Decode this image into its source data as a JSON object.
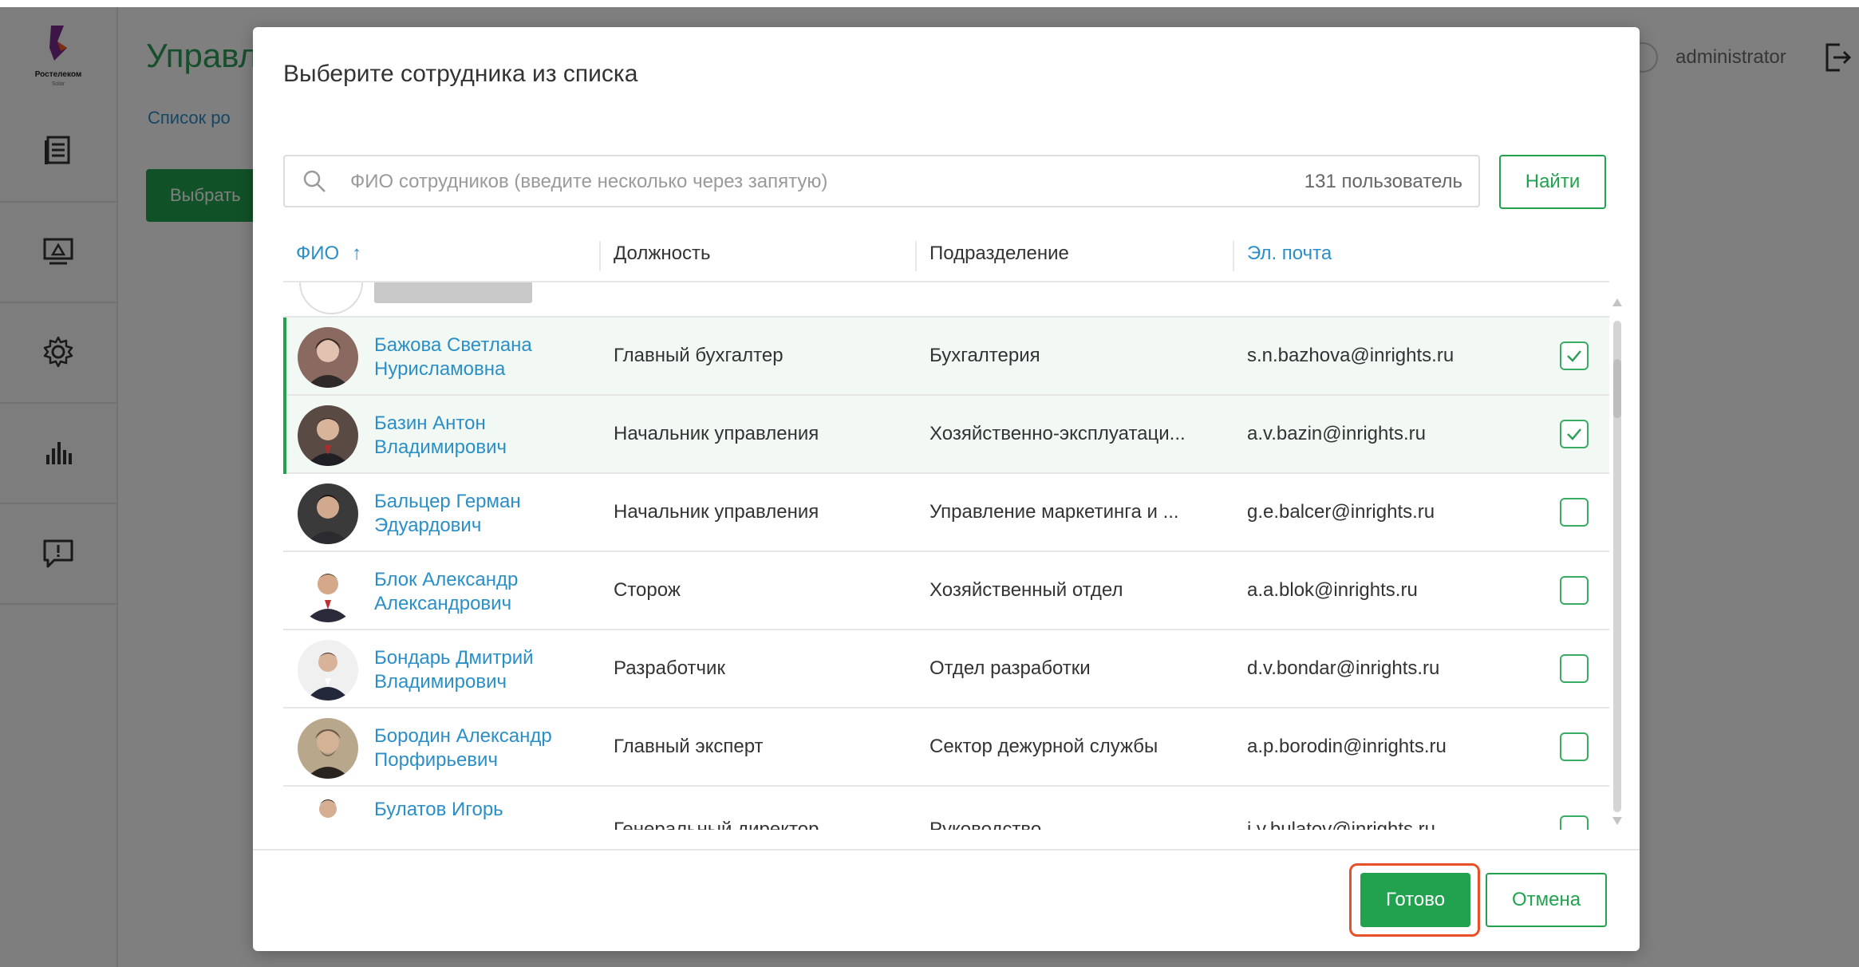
{
  "app": {
    "logo_text": "Ростелеком",
    "logo_sub": "Solar",
    "title": "Управл",
    "breadcrumb": "Список ро",
    "choose_button": "Выбрать",
    "username": "administrator",
    "accent_color": "#22a24f",
    "link_color": "#2b8fc7"
  },
  "sidebar": {
    "items": [
      {
        "icon": "document-list-icon"
      },
      {
        "icon": "monitor-icon"
      },
      {
        "icon": "gear-icon"
      },
      {
        "icon": "bar-chart-icon"
      },
      {
        "icon": "feedback-icon"
      }
    ]
  },
  "modal": {
    "title": "Выберите сотрудника из списка",
    "search": {
      "placeholder": "ФИО сотрудников (введите несколько через запятую)",
      "value": "",
      "count": "131 пользователь"
    },
    "find_button": "Найти",
    "columns": {
      "name": "ФИО",
      "sort_indicator": "↑",
      "position": "Должность",
      "department": "Подразделение",
      "email": "Эл. почта"
    },
    "rows": [
      {
        "name": "Бажова Светлана Нурисламовна",
        "position": "Главный бухгалтер",
        "department": "Бухгалтерия",
        "email": "s.n.bazhova@inrights.ru",
        "checked": true,
        "selected": true
      },
      {
        "name": "Базин Антон Владимирович",
        "position": "Начальник управления",
        "department": "Хозяйственно-эксплуатаци...",
        "email": "a.v.bazin@inrights.ru",
        "checked": true,
        "selected": true
      },
      {
        "name": "Бальцер Герман Эдуардович",
        "position": "Начальник управления",
        "department": "Управление маркетинга и ...",
        "email": "g.e.balcer@inrights.ru",
        "checked": false,
        "selected": false
      },
      {
        "name": "Блок Александр Александрович",
        "position": "Сторож",
        "department": "Хозяйственный отдел",
        "email": "a.a.blok@inrights.ru",
        "checked": false,
        "selected": false
      },
      {
        "name": "Бондарь Дмитрий Владимирович",
        "position": "Разработчик",
        "department": "Отдел разработки",
        "email": "d.v.bondar@inrights.ru",
        "checked": false,
        "selected": false
      },
      {
        "name": "Бородин Александр Порфирьевич",
        "position": "Главный эксперт",
        "department": "Сектор дежурной службы",
        "email": "a.p.borodin@inrights.ru",
        "checked": false,
        "selected": false
      },
      {
        "name": "Булатов Игорь",
        "position": "Генеральный директор",
        "department": "Руководство",
        "email": "i.v.bulatov@inrights.ru",
        "checked": false,
        "selected": false
      }
    ],
    "done_button": "Готово",
    "cancel_button": "Отмена"
  }
}
